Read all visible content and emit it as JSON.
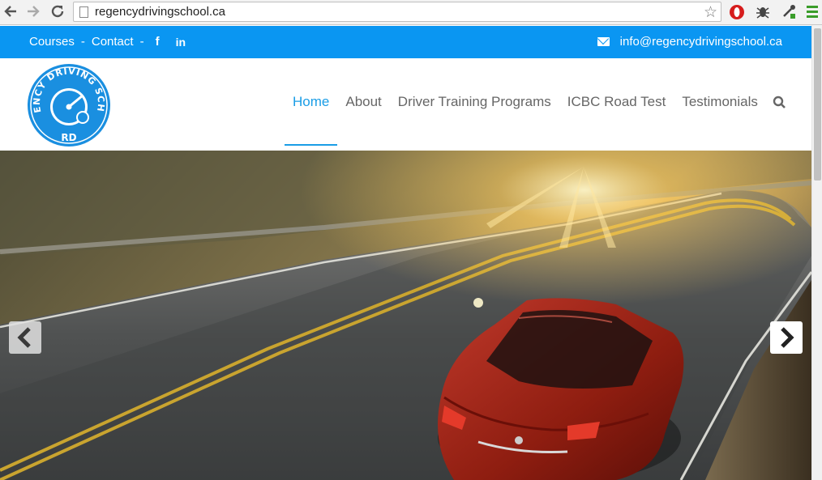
{
  "browser": {
    "url": "regencydrivingschool.ca",
    "back_icon": "arrow-left-icon",
    "forward_icon": "arrow-right-icon",
    "reload_icon": "reload-icon",
    "bookmark_icon": "star-icon"
  },
  "topbar": {
    "links": [
      "Courses",
      "Contact"
    ],
    "separator": "-",
    "facebook": "f",
    "linkedin": "in",
    "email": "info@regencydrivingschool.ca",
    "bg_color": "#0a96f2"
  },
  "logo": {
    "text_arc": "REGENCY DRIVING SCHOOL",
    "initials": "RD",
    "color": "#1a8fe0"
  },
  "nav": {
    "items": [
      {
        "label": "Home",
        "active": true
      },
      {
        "label": "About",
        "active": false
      },
      {
        "label": "Driver Training Programs",
        "active": false
      },
      {
        "label": "ICBC Road Test",
        "active": false
      },
      {
        "label": "Testimonials",
        "active": false
      }
    ],
    "search_icon": "search-icon",
    "accent_color": "#1a9de6"
  },
  "hero": {
    "image": "red-sedan-on-winding-road-at-sunset",
    "prev_icon": "chevron-left-icon",
    "next_icon": "chevron-right-icon"
  }
}
